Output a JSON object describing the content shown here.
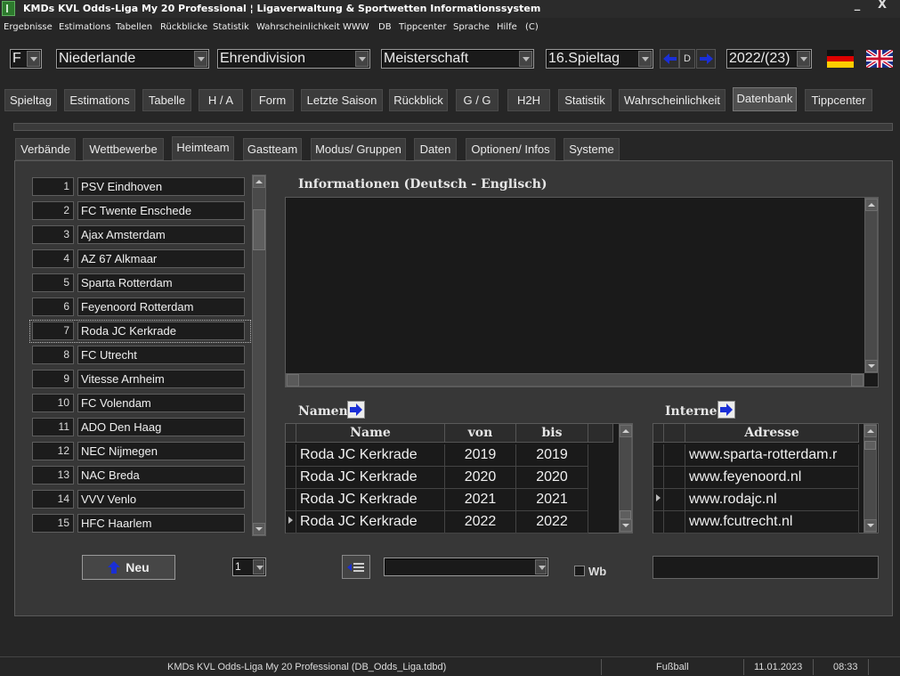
{
  "window": {
    "title": "KMDs KVL Odds-Liga My 20 Professional ¦ Ligaverwaltung & Sportwetten Informationssystem",
    "minimize_glyph": "_",
    "close_glyph": "X"
  },
  "menu": [
    "Ergebnisse",
    "Estimations",
    "Tabellen",
    "Rückblicke",
    "Statistik",
    "Wahrscheinlichkeit",
    "WWW",
    "DB",
    "Tippcenter",
    "Sprache",
    "Hilfe",
    "(C)"
  ],
  "toolbar": {
    "letter": "F",
    "country": "Niederlande",
    "league": "Ehrendivision",
    "competition": "Meisterschaft",
    "matchday": "16.Spieltag",
    "nav_mid": "D",
    "season": "2022/(23)"
  },
  "main_tabs": [
    "Spieltag",
    "Estimations",
    "Tabelle",
    "H / A",
    "Form",
    "Letzte Saison",
    "Rückblick",
    "G / G",
    "H2H",
    "Statistik",
    "Wahrscheinlichkeit",
    "Datenbank",
    "Tippcenter"
  ],
  "main_tab_active": "Datenbank",
  "sub_tabs": [
    "Verbände",
    "Wettbewerbe",
    "Heimteam",
    "Gastteam",
    "Modus/ Gruppen",
    "Daten",
    "Optionen/ Infos",
    "Systeme"
  ],
  "sub_tab_active": "Heimteam",
  "teams": [
    {
      "num": "1",
      "name": "PSV Eindhoven"
    },
    {
      "num": "2",
      "name": "FC Twente Enschede"
    },
    {
      "num": "3",
      "name": "Ajax Amsterdam"
    },
    {
      "num": "4",
      "name": "AZ 67 Alkmaar"
    },
    {
      "num": "5",
      "name": "Sparta Rotterdam"
    },
    {
      "num": "6",
      "name": "Feyenoord Rotterdam"
    },
    {
      "num": "7",
      "name": "Roda JC Kerkrade"
    },
    {
      "num": "8",
      "name": "FC Utrecht"
    },
    {
      "num": "9",
      "name": "Vitesse Arnheim"
    },
    {
      "num": "10",
      "name": "FC Volendam"
    },
    {
      "num": "11",
      "name": "ADO Den Haag"
    },
    {
      "num": "12",
      "name": "NEC Nijmegen"
    },
    {
      "num": "13",
      "name": "NAC Breda"
    },
    {
      "num": "14",
      "name": "VVV Venlo"
    },
    {
      "num": "15",
      "name": "HFC Haarlem"
    }
  ],
  "selected_team": "Roda JC Kerkrade",
  "info": {
    "title": "Informationen (Deutsch - Englisch)",
    "text": ""
  },
  "names": {
    "title": "Namen",
    "headers": [
      "Name",
      "von",
      "bis"
    ],
    "rows": [
      {
        "name": "Roda JC Kerkrade",
        "von": "2019",
        "bis": "2019"
      },
      {
        "name": "Roda JC Kerkrade",
        "von": "2020",
        "bis": "2020"
      },
      {
        "name": "Roda JC Kerkrade",
        "von": "2021",
        "bis": "2021"
      },
      {
        "name": "Roda JC Kerkrade",
        "von": "2022",
        "bis": "2022"
      }
    ]
  },
  "internet": {
    "title": "Internet",
    "header": "Adresse",
    "rows": [
      "www.sparta-rotterdam.r",
      "www.feyenoord.nl",
      "www.rodajc.nl",
      "www.fcutrecht.nl"
    ]
  },
  "bottom": {
    "neu_label": "Neu",
    "page_value": "1",
    "dropdown_value": "",
    "wb_label": "Wb",
    "text_value": ""
  },
  "status": {
    "app": "KMDs KVL Odds-Liga My 20 Professional  (DB_Odds_Liga.tdbd)",
    "sport": "Fußball",
    "date": "11.01.2023",
    "time": "08:33"
  },
  "colors": {
    "accent_arrow": "#1a2fd6",
    "background": "#262626",
    "panel": "#373737"
  }
}
